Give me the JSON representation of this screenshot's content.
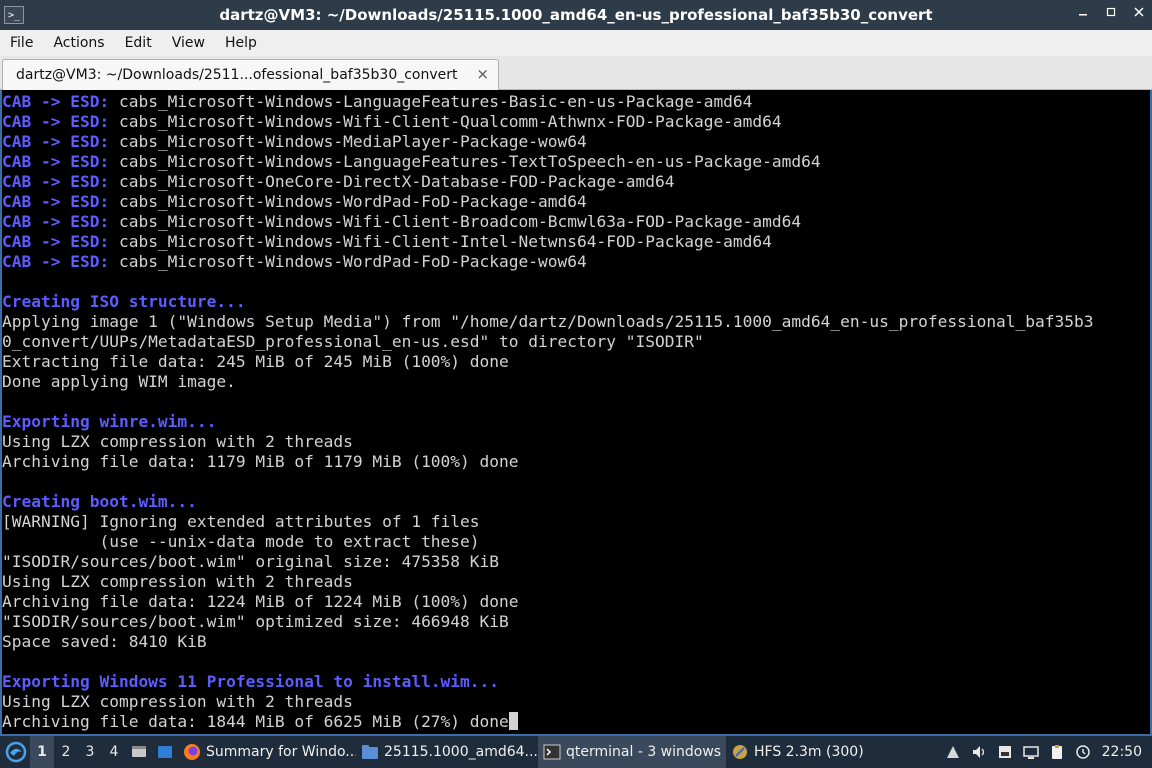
{
  "window": {
    "title": "dartz@VM3: ~/Downloads/25115.1000_amd64_en-us_professional_baf35b30_convert",
    "icon_label": ">_",
    "controls": [
      "min-icon",
      "max-icon",
      "close-icon"
    ]
  },
  "menubar": {
    "items": [
      "File",
      "Actions",
      "Edit",
      "View",
      "Help"
    ]
  },
  "tab": {
    "label": "dartz@VM3: ~/Downloads/2511...ofessional_baf35b30_convert",
    "close": "×"
  },
  "terminal": {
    "lines": [
      {
        "p": "CAB -> ESD: ",
        "t": "cabs_Microsoft-Windows-LanguageFeatures-Basic-en-us-Package-amd64"
      },
      {
        "p": "CAB -> ESD: ",
        "t": "cabs_Microsoft-Windows-Wifi-Client-Qualcomm-Athwnx-FOD-Package-amd64"
      },
      {
        "p": "CAB -> ESD: ",
        "t": "cabs_Microsoft-Windows-MediaPlayer-Package-wow64"
      },
      {
        "p": "CAB -> ESD: ",
        "t": "cabs_Microsoft-Windows-LanguageFeatures-TextToSpeech-en-us-Package-amd64"
      },
      {
        "p": "CAB -> ESD: ",
        "t": "cabs_Microsoft-OneCore-DirectX-Database-FOD-Package-amd64"
      },
      {
        "p": "CAB -> ESD: ",
        "t": "cabs_Microsoft-Windows-WordPad-FoD-Package-amd64"
      },
      {
        "p": "CAB -> ESD: ",
        "t": "cabs_Microsoft-Windows-Wifi-Client-Broadcom-Bcmwl63a-FOD-Package-amd64"
      },
      {
        "p": "CAB -> ESD: ",
        "t": "cabs_Microsoft-Windows-Wifi-Client-Intel-Netwns64-FOD-Package-amd64"
      },
      {
        "p": "CAB -> ESD: ",
        "t": "cabs_Microsoft-Windows-WordPad-FoD-Package-wow64"
      },
      {
        "t": ""
      },
      {
        "h": "Creating ISO structure..."
      },
      {
        "t": "Applying image 1 (\"Windows Setup Media\") from \"/home/dartz/Downloads/25115.1000_amd64_en-us_professional_baf35b3"
      },
      {
        "t": "0_convert/UUPs/MetadataESD_professional_en-us.esd\" to directory \"ISODIR\""
      },
      {
        "t": "Extracting file data: 245 MiB of 245 MiB (100%) done"
      },
      {
        "t": "Done applying WIM image."
      },
      {
        "t": ""
      },
      {
        "h": "Exporting winre.wim..."
      },
      {
        "t": "Using LZX compression with 2 threads"
      },
      {
        "t": "Archiving file data: 1179 MiB of 1179 MiB (100%) done"
      },
      {
        "t": ""
      },
      {
        "h": "Creating boot.wim..."
      },
      {
        "t": "[WARNING] Ignoring extended attributes of 1 files"
      },
      {
        "t": "          (use --unix-data mode to extract these)"
      },
      {
        "t": "\"ISODIR/sources/boot.wim\" original size: 475358 KiB"
      },
      {
        "t": "Using LZX compression with 2 threads"
      },
      {
        "t": "Archiving file data: 1224 MiB of 1224 MiB (100%) done"
      },
      {
        "t": "\"ISODIR/sources/boot.wim\" optimized size: 466948 KiB"
      },
      {
        "t": "Space saved: 8410 KiB"
      },
      {
        "t": ""
      },
      {
        "h": "Exporting Windows 11 Professional to install.wim..."
      },
      {
        "t": "Using LZX compression with 2 threads"
      },
      {
        "t": "Archiving file data: 1844 MiB of 6625 MiB (27%) done",
        "cursor": true
      }
    ],
    "prefix_color": "#5c5cff",
    "text_color": "#d3d3d3"
  },
  "taskbar": {
    "workspaces": [
      "1",
      "2",
      "3",
      "4"
    ],
    "active_workspace": "1",
    "tasks": [
      {
        "label": "Summary for Windo...",
        "icon": "firefox-icon"
      },
      {
        "label": "25115.1000_amd64...",
        "icon": "folder-icon"
      },
      {
        "label": "qterminal - 3 windows",
        "icon": "terminal-icon",
        "active": true
      },
      {
        "label": "HFS 2.3m (300)",
        "icon": "hfs-icon"
      }
    ],
    "tray_icons": [
      "network-icon",
      "volume-icon",
      "hfs-tray-icon",
      "display-icon",
      "clipboard-icon",
      "update-icon"
    ],
    "clock": "22:50"
  }
}
